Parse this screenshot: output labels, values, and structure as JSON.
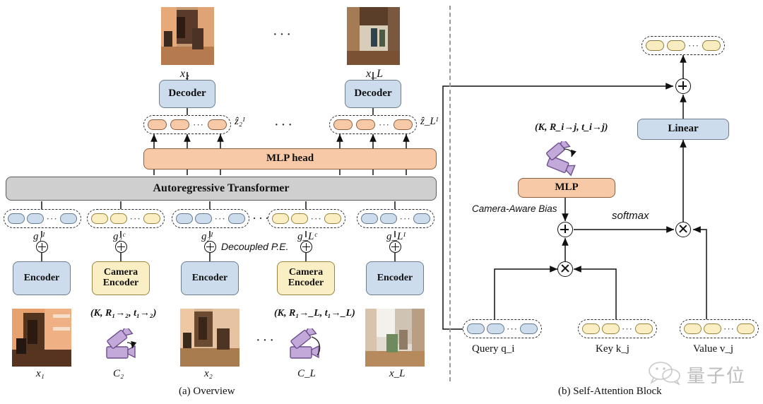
{
  "figure": {
    "captions": [
      {
        "id": "a",
        "text": "(a) Overview"
      },
      {
        "id": "b",
        "text": "(b) Self-Attention Block"
      }
    ],
    "watermark": "量子位"
  },
  "colors": {
    "blue": "#ccdcec",
    "yellow": "#faeec4",
    "orange": "#f8c9a6",
    "gray": "#cfcfcf",
    "camera_purple": "#bda6d6",
    "stroke": "#2a2a2a"
  },
  "overview": {
    "transformer_label": "Autoregressive Transformer",
    "mlp_head_label": "MLP head",
    "decoupled_pe_label": "Decoupled P.E.",
    "decoders": [
      {
        "label": "Decoder",
        "image_label": "x₂"
      },
      {
        "label": "Decoder",
        "image_label": "x_L"
      }
    ],
    "output_tokens": [
      {
        "label": "ẑ₂ᴵ"
      },
      {
        "label": "ẑ_Lᴵ"
      }
    ],
    "input_tokens": [
      {
        "label": "g₁ᴵ",
        "kind": "image"
      },
      {
        "label": "g₂ᶜ",
        "kind": "camera"
      },
      {
        "label": "g₂ᴵ",
        "kind": "image"
      },
      {
        "label": "g_Lᶜ",
        "kind": "camera"
      },
      {
        "label": "g_Lᴵ",
        "kind": "image"
      }
    ],
    "encoders": [
      {
        "label": "Encoder",
        "kind": "image"
      },
      {
        "label": "Camera Encoder",
        "kind": "camera"
      },
      {
        "label": "Encoder",
        "kind": "image"
      },
      {
        "label": "Camera Encoder",
        "kind": "camera"
      },
      {
        "label": "Encoder",
        "kind": "image"
      }
    ],
    "inputs": [
      {
        "type": "image",
        "label": "x₁"
      },
      {
        "type": "camera",
        "label": "C₂",
        "params": "(K, R₁→₂, t₁→₂)"
      },
      {
        "type": "image",
        "label": "x₂"
      },
      {
        "type": "camera",
        "label": "C_L",
        "params": "(K, R₁→_L, t₁→_L)"
      },
      {
        "type": "image",
        "label": "x_L"
      }
    ],
    "plus_symbol": "⊕",
    "ellipsis": "···"
  },
  "attention": {
    "linear_label": "Linear",
    "mlp_label": "MLP",
    "camera_params_label": "(K, R_i→j, t_i→j)",
    "bias_label": "Camera-Aware Bias",
    "softmax_label": "softmax",
    "inputs": [
      {
        "name": "query",
        "label": "Query q_i",
        "kind": "query"
      },
      {
        "name": "key",
        "label": "Key k_j",
        "kind": "key"
      },
      {
        "name": "value",
        "label": "Value v_j",
        "kind": "value"
      }
    ],
    "output_tokens_label": ""
  }
}
